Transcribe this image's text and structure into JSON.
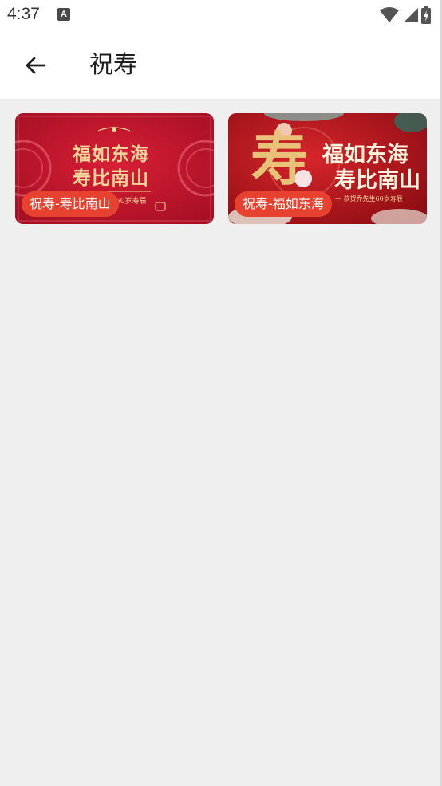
{
  "status_bar": {
    "time": "4:37",
    "notification_icon_letter": "A",
    "icons": [
      "notification-a-icon",
      "wifi-icon",
      "signal-icon",
      "battery-charging-icon"
    ]
  },
  "app_bar": {
    "title": "祝寿",
    "back_icon": "arrow-left-icon"
  },
  "cards": [
    {
      "label": "祝寿-寿比南山",
      "art_line1": "福如东海",
      "art_line2": "寿比南山",
      "art_caption": "60岁寿辰"
    },
    {
      "label": "祝寿-福如东海",
      "art_big_char": "寿",
      "art_line1": "福如东海",
      "art_line2": "寿比南山",
      "art_caption": "— 恭贺乔先生60岁寿辰"
    }
  ],
  "colors": {
    "label_bg": "#e7422f",
    "card1_bg": "#c5172d",
    "card2_bg": "#b3121c",
    "gold": "#f3d79b",
    "background": "#f0eff0"
  }
}
